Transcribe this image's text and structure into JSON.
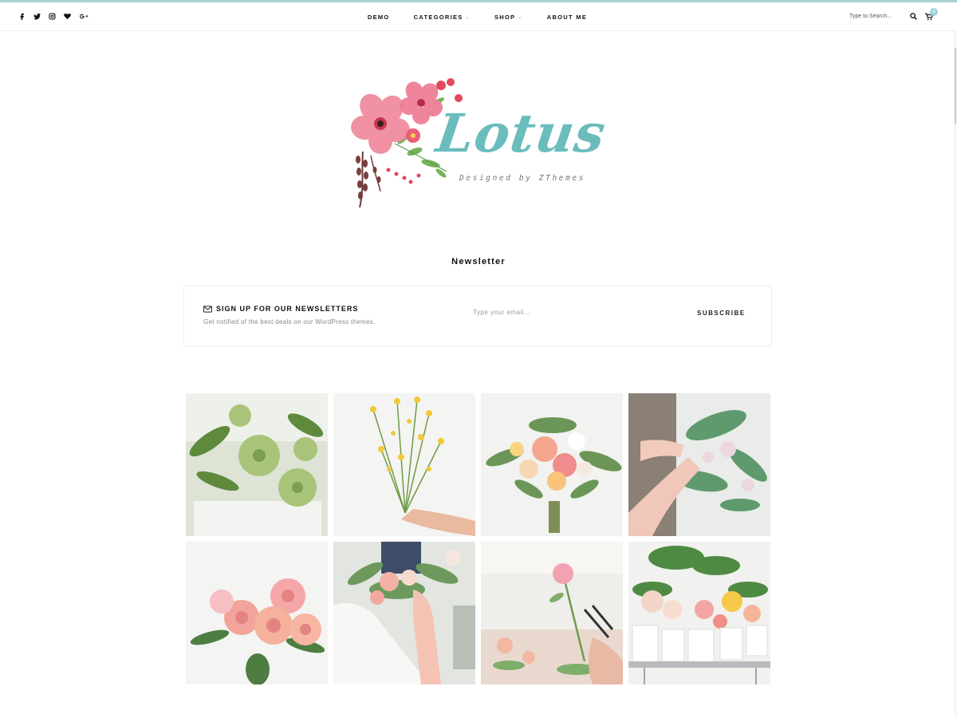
{
  "theme": {
    "accent": "#a8d0d2",
    "logo_color": "#6bbcbd",
    "badge_color": "#9ed3d6"
  },
  "topbar": {
    "socials": [
      {
        "name": "facebook-icon",
        "glyph": "f"
      },
      {
        "name": "twitter-icon",
        "glyph": "t"
      },
      {
        "name": "instagram-icon",
        "glyph": "i"
      },
      {
        "name": "heart-icon",
        "glyph": "heart"
      },
      {
        "name": "google-plus-icon",
        "glyph": "G+"
      }
    ],
    "nav": {
      "demo": "DEMO",
      "categories": "CATEGORIES",
      "shop": "SHOP",
      "about": "ABOUT ME"
    },
    "search_placeholder": "Type to Search...",
    "cart_count": "0"
  },
  "logo": {
    "title": "Lotus",
    "tagline": "Designed by ZThemes"
  },
  "newsletter": {
    "section_title": "Newsletter",
    "heading": "SIGN UP FOR OUR NEWSLETTERS",
    "subtext": "Get notified of the best deals on our WordPress themes.",
    "email_placeholder": "Type your email...",
    "button": "SUBSCRIBE"
  },
  "gallery": {
    "images": [
      {
        "subject": "green-hellebore"
      },
      {
        "subject": "yellow-wildflower-bouquet"
      },
      {
        "subject": "peach-rose-bouquet"
      },
      {
        "subject": "arranging-greenery"
      },
      {
        "subject": "pink-garden-roses"
      },
      {
        "subject": "florist-arranging-bouquet"
      },
      {
        "subject": "cutting-rose-stem"
      },
      {
        "subject": "flower-buckets-market"
      }
    ]
  }
}
